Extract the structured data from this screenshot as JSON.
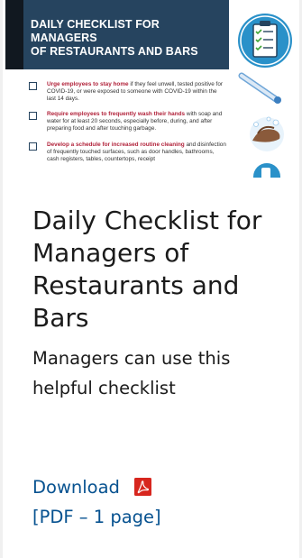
{
  "thumbnail": {
    "title_line1": "DAILY CHECKLIST FOR MANAGERS",
    "title_line2": "OF RESTAURANTS AND BARS",
    "items": [
      {
        "highlight": "Urge employees to stay home",
        "text": " if they feel unwell, tested positive for COVID-19, or were exposed to someone with COVID-19 within the last 14 days."
      },
      {
        "highlight": "Require employees to frequently wash their hands",
        "text": " with soap and water for at least 20 seconds, especially before, during, and after preparing food and after touching garbage."
      },
      {
        "highlight": "Develop a schedule for increased routine cleaning",
        "text": " and disinfection of frequently touched surfaces, such as door handles, bathrooms, cash registers, tables, countertops, receipt"
      }
    ]
  },
  "card": {
    "title": "Daily Checklist for Managers of Restaurants and Bars",
    "description": "Managers can use this helpful checklist",
    "download_label": "Download",
    "file_info": "[PDF – 1 page]"
  },
  "colors": {
    "header_navy": "#26445f",
    "highlight_red": "#b1223a",
    "link_blue": "#075290",
    "pdf_red": "#d7261e",
    "text": "#1b1b1b"
  },
  "icons": [
    "clipboard-checklist-icon",
    "thermometer-icon",
    "hand-washing-icon",
    "spray-bottle-icon",
    "pdf-icon"
  ]
}
